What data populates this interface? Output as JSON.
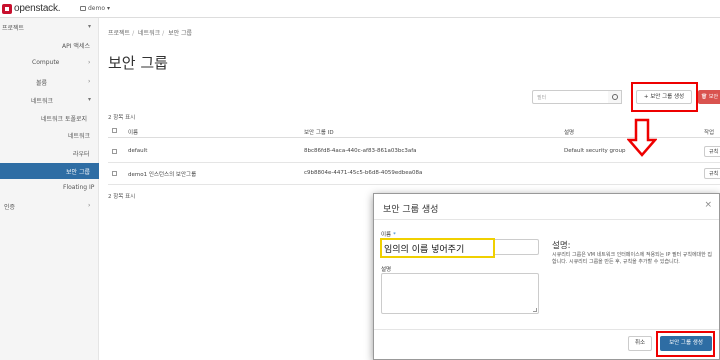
{
  "topbar": {
    "logo_text": "openstack.",
    "project": "demo"
  },
  "sidebar": {
    "items": [
      {
        "label": "프로젝트",
        "chevron": "▾"
      },
      {
        "label": "API 액세스"
      },
      {
        "label": "Compute",
        "chevron": "›"
      },
      {
        "label": "볼륨",
        "chevron": "›"
      },
      {
        "label": "네트워크",
        "chevron": "▾"
      },
      {
        "label": "네트워크 토폴로지"
      },
      {
        "label": "네트워크"
      },
      {
        "label": "라우터"
      },
      {
        "label": "보안 그룹"
      },
      {
        "label": "Floating IP"
      },
      {
        "label": "인증",
        "chevron": "›"
      }
    ]
  },
  "main": {
    "breadcrumb": [
      "프로젝트",
      "네트워크",
      "보안 그룹"
    ],
    "title": "보안 그룹",
    "filter_placeholder": "필터",
    "create_button": "+ 보안 그룹 생성",
    "delete_button": "🗑 보안",
    "count_top": "2 항목 표시",
    "count_bottom": "2 항목 표시",
    "table": {
      "headers": [
        "이름",
        "보안 그룹 ID",
        "설명",
        "작업"
      ],
      "rows": [
        {
          "name": "default",
          "id": "8bc86fd8-4aca-440c-af83-861a03bc3afa",
          "desc": "Default security group",
          "action": "규칙"
        },
        {
          "name": "demo1 인스턴스의 보안그룹",
          "id": "c9b8804e-4471-45c5-b6d8-4059edbea08a",
          "desc": "",
          "action": "규칙"
        }
      ]
    }
  },
  "modal": {
    "title": "보안 그룹 생성",
    "close": "×",
    "name_label": "이름",
    "required_mark": "*",
    "name_value": "임의의 이름 넣어주기",
    "desc_label": "설명",
    "help_title": "설명:",
    "help_text": "시큐리티 그룹은 VM 네트워크 인터페이스에 적용되는 IP 필터 규칙에대한 집합니다. 시큐리티 그룹을 만든 후, 규칙을 추가할 수 있습니다.",
    "cancel": "취소",
    "submit": "보안 그룹 생성"
  }
}
